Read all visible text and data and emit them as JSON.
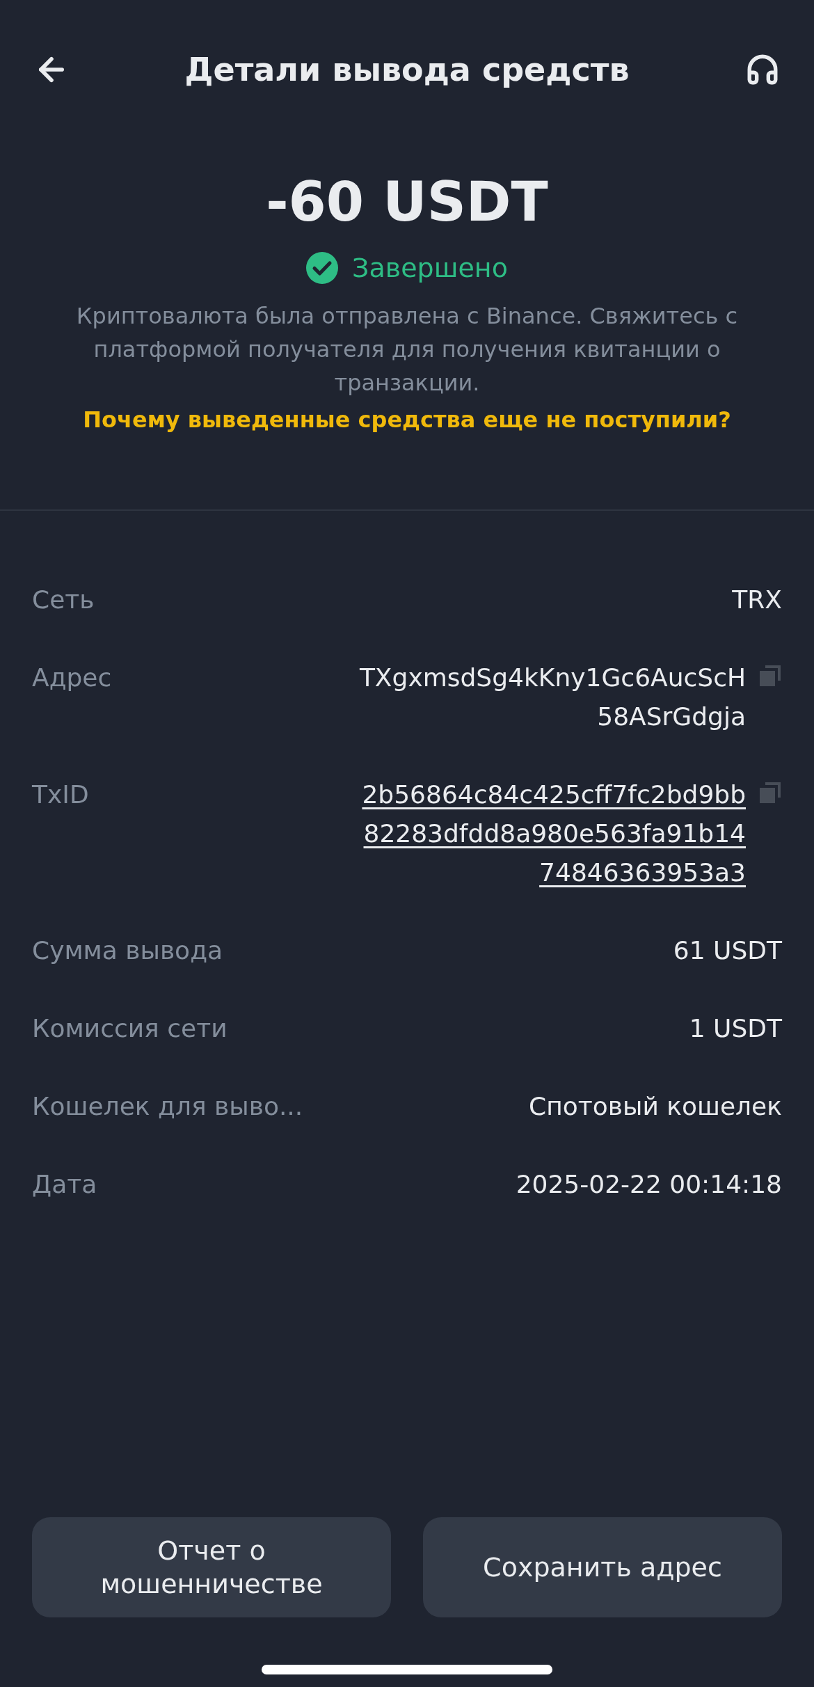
{
  "header": {
    "title": "Детали вывода средств"
  },
  "amount": "-60 USDT",
  "status": {
    "label": "Завершено",
    "completed": true
  },
  "description": "Криптовалюта была отправлена с Binance. Свяжитесь с платформой получателя для получения квитанции о транзакции.",
  "help_link": "Почему выведенные средства еще не поступили?",
  "details": [
    {
      "label": "Сеть",
      "value": "TRX",
      "kind": "plain"
    },
    {
      "label": "Адрес",
      "value": "TXgxmsdSg4kKny1Gc6AucScH58ASrGdgja",
      "kind": "copyable"
    },
    {
      "label": "TxID",
      "value": "2b56864c84c425cff7fc2bd9bb82283dfdd8a980e563fa91b1474846363953a3",
      "kind": "copyable-link"
    },
    {
      "label": "Сумма вывода",
      "value": "61 USDT",
      "kind": "plain"
    },
    {
      "label": "Комиссия сети",
      "value": "1 USDT",
      "kind": "plain"
    },
    {
      "label": "Кошелек для выво...",
      "value": "Спотовый кошелек",
      "kind": "plain"
    },
    {
      "label": "Дата",
      "value": "2025-02-22 00:14:18",
      "kind": "plain"
    }
  ],
  "buttons": [
    "Отчет о мошенничестве",
    "Сохранить адрес"
  ]
}
